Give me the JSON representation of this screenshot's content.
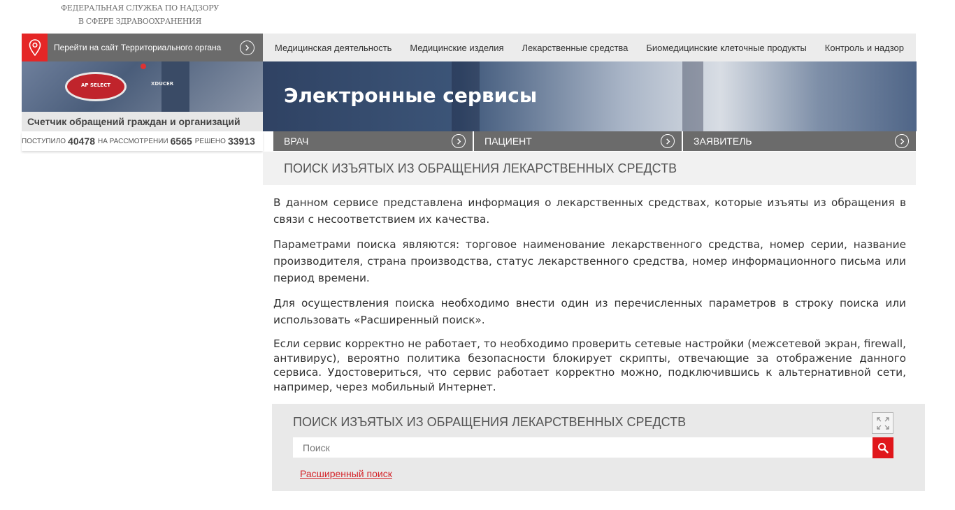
{
  "header": {
    "org_line1": "ФЕДЕРАЛЬНАЯ СЛУЖБА ПО НАДЗОРУ",
    "org_line2": "В СФЕРЕ ЗДРАВООХРАНЕНИЯ"
  },
  "territorial": {
    "label": "Перейти на сайт Территориального органа",
    "icon": "map-pin-icon"
  },
  "topnav": [
    "Медицинская деятельность",
    "Медицинские изделия",
    "Лекарственные средства",
    "Биомедицинские клеточные продукты",
    "Контроль и надзор"
  ],
  "banner": {
    "title": "Электронные сервисы",
    "device_label": "AP SELECT",
    "device_text": "XDUCER"
  },
  "counter": {
    "title": "Счетчик обращений граждан и организаций",
    "received_label": "поступило",
    "received_value": "40478",
    "review_label": "на рассмотрении",
    "review_value": "6565",
    "solved_label": "решено",
    "solved_value": "33913"
  },
  "roles": [
    "Врач",
    "Пациент",
    "Заявитель"
  ],
  "section_title": "ПОИСК ИЗЪЯТЫХ ИЗ ОБРАЩЕНИЯ ЛЕКАРСТВЕННЫХ СРЕДСТВ",
  "content": {
    "p1": "В данном сервисе представлена информация о лекарственных средствах, которые изъяты из обращения  в связи с несоответствием их качества.",
    "p2": "Параметрами поиска являются: торговое наименование лекарственного средства, номер серии, название производителя, страна производства, статус лекарственного средства, номер информационного письма или период времени.",
    "p3": "Для осуществления поиска необходимо внести один из  перечисленных параметров в строку поиска или использовать «Расширенный поиск».",
    "p4": "Если сервис корректно не работает, то необходимо проверить сетевые настройки (межсетевой экран, firewall, антивирус), вероятно политика безопасности блокирует скрипты, отвечающие за отображение данного сервиса. Удостовериться, что сервис работает корректно можно, подключившись к альтернативной сети, например, через мобильный Интернет."
  },
  "search": {
    "title": "ПОИСК ИЗЪЯТЫХ ИЗ ОБРАЩЕНИЯ ЛЕКАРСТВЕННЫХ СРЕДСТВ",
    "placeholder": "Поиск",
    "value": "",
    "advanced_link": "Расширенный поиск",
    "accent": "#e0161b"
  }
}
